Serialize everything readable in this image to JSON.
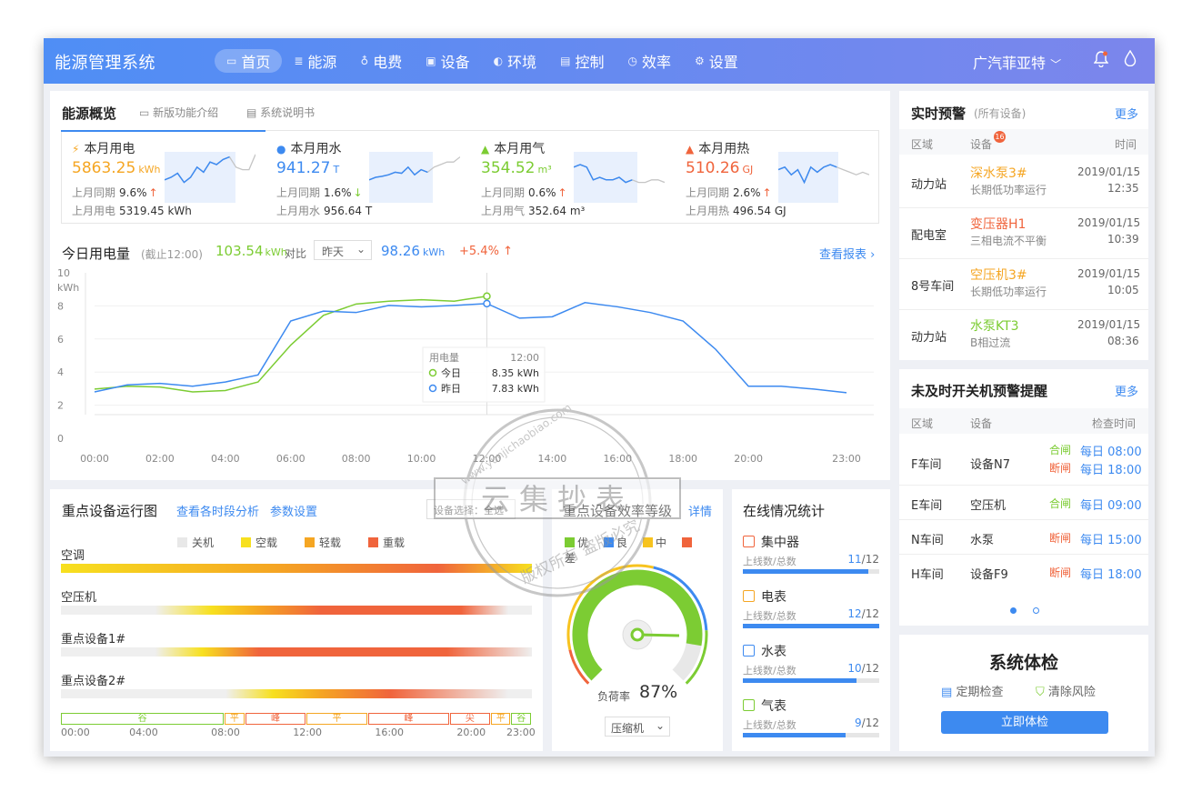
{
  "app": {
    "title": "能源管理系统"
  },
  "nav": [
    {
      "label": "首页",
      "icon": "monitor-icon",
      "active": true
    },
    {
      "label": "能源",
      "icon": "database-icon"
    },
    {
      "label": "电费",
      "icon": "bulb-icon"
    },
    {
      "label": "设备",
      "icon": "device-icon"
    },
    {
      "label": "环境",
      "icon": "leaf-icon"
    },
    {
      "label": "控制",
      "icon": "control-icon"
    },
    {
      "label": "效率",
      "icon": "clock-icon"
    },
    {
      "label": "设置",
      "icon": "gear-icon"
    }
  ],
  "header": {
    "company": "广汽菲亚特"
  },
  "overview": {
    "title": "能源概览",
    "link1": "新版功能介绍",
    "link2": "系统说明书",
    "metrics": [
      {
        "title": "本月用电",
        "value": "5863.25",
        "unit": "kWh",
        "yoy_label": "上月同期",
        "yoy": "9.6%",
        "prev_label": "上月用电",
        "prev": "5319.45 kWh",
        "color": "#f5a623",
        "icon": "lightning-icon",
        "spark": [
          0.55,
          0.5,
          0.42,
          0.6,
          0.5,
          0.3,
          0.4,
          0.2,
          0.25,
          0.15,
          0.1,
          0.3,
          0.35,
          0.35,
          0.05
        ],
        "fill": 0.78
      },
      {
        "title": "本月用水",
        "value": "941.27",
        "unit": "T",
        "yoy_label": "上月同期",
        "yoy": "1.6%",
        "prev_label": "上月用水",
        "prev": "956.64 T",
        "color": "#3d8af0",
        "icon": "water-drop-icon",
        "spark": [
          0.55,
          0.5,
          0.48,
          0.45,
          0.4,
          0.42,
          0.3,
          0.45,
          0.35,
          0.4,
          0.3,
          0.25,
          0.2,
          0.2,
          0.1
        ],
        "fill": 0.7
      },
      {
        "title": "本月用气",
        "value": "354.52",
        "unit": "m³",
        "yoy_label": "上月同期",
        "yoy": "0.6%",
        "prev_label": "上月用气",
        "prev": "352.64 m³",
        "color": "#7ccc33",
        "icon": "flame-icon",
        "spark": [
          0.3,
          0.25,
          0.3,
          0.55,
          0.5,
          0.55,
          0.55,
          0.5,
          0.6,
          0.55,
          0.6,
          0.6,
          0.55,
          0.55,
          0.6
        ],
        "fill": 0.7
      },
      {
        "title": "本月用热",
        "value": "510.26",
        "unit": "GJ",
        "yoy_label": "上月同期",
        "yoy": "2.6%",
        "prev_label": "上月用热",
        "prev": "496.54 GJ",
        "color": "#f0643c",
        "icon": "heat-icon",
        "spark": [
          0.35,
          0.3,
          0.45,
          0.35,
          0.6,
          0.3,
          0.4,
          0.3,
          0.25,
          0.3,
          0.35,
          0.4,
          0.45,
          0.4,
          0.45
        ],
        "fill": 0.66
      }
    ]
  },
  "today": {
    "title": "今日用电量",
    "note": "(截止12:00)",
    "value": "103.54",
    "unit": "kWh",
    "compare_label": "对比",
    "select": "昨天",
    "compare_value": "98.26",
    "compare_unit": "kWh",
    "change": "+5.4%",
    "report_link": "查看报表"
  },
  "chart_data": {
    "type": "line",
    "ylabel": "kWh",
    "ylim": [
      0,
      10
    ],
    "yticks": [
      "0",
      "2",
      "4",
      "6",
      "8",
      "10"
    ],
    "xticks": [
      "00:00",
      "02:00",
      "04:00",
      "06:00",
      "08:00",
      "10:00",
      "12:00",
      "14:00",
      "16:00",
      "18:00",
      "20:00",
      "23:00"
    ],
    "x_hours": [
      0,
      1,
      2,
      3,
      4,
      5,
      6,
      7,
      8,
      9,
      10,
      11,
      12,
      13,
      14,
      15,
      16,
      17,
      18,
      19,
      20,
      21,
      22,
      23
    ],
    "series": [
      {
        "name": "今日",
        "color": "#7ccc33",
        "values": [
          1.8,
          2.0,
          1.95,
          1.6,
          1.7,
          2.3,
          4.9,
          7.0,
          7.8,
          8.0,
          8.1,
          8.0,
          8.35
        ]
      },
      {
        "name": "昨日",
        "color": "#3d8af0",
        "values": [
          1.6,
          2.1,
          2.2,
          2.0,
          2.3,
          2.8,
          6.6,
          7.3,
          7.2,
          7.7,
          7.6,
          7.7,
          7.83,
          6.8,
          6.9,
          7.9,
          7.6,
          7.2,
          6.6,
          4.6,
          2.0,
          2.0,
          1.8,
          1.55
        ]
      }
    ],
    "tooltip": {
      "title": "用电量",
      "time": "12:00",
      "rows": [
        {
          "label": "今日",
          "value": "8.35 kWh"
        },
        {
          "label": "昨日",
          "value": "7.83 kWh"
        }
      ]
    }
  },
  "alerts": {
    "title": "实时预警",
    "subtitle": "(所有设备)",
    "more": "更多",
    "headers": [
      "区域",
      "设备",
      "时间"
    ],
    "badge": "16",
    "rows": [
      {
        "area": "动力站",
        "device": "深水泵3#",
        "desc": "长期低功率运行",
        "date": "2019/01/15",
        "time": "12:35",
        "color": "#f5a623"
      },
      {
        "area": "配电室",
        "device": "变压器H1",
        "desc": "三相电流不平衡",
        "date": "2019/01/15",
        "time": "10:39",
        "color": "#f0643c"
      },
      {
        "area": "8号车间",
        "device": "空压机3#",
        "desc": "长期低功率运行",
        "date": "2019/01/15",
        "time": "10:05",
        "color": "#f5a623"
      },
      {
        "area": "动力站",
        "device": "水泵KT3",
        "desc": "B相过流",
        "date": "2019/01/15",
        "time": "08:36",
        "color": "#7ccc33"
      }
    ]
  },
  "switch_alert": {
    "title": "未及时开关机预警提醒",
    "more": "更多",
    "headers": [
      "区域",
      "设备",
      "检查时间"
    ],
    "rows": [
      {
        "area": "F车间",
        "device": "设备N7",
        "items": [
          {
            "label": "合闸",
            "time": "每日 08:00",
            "color": "#7ccc33"
          },
          {
            "label": "断闸",
            "time": "每日 18:00",
            "color": "#f0643c"
          }
        ]
      },
      {
        "area": "E车间",
        "device": "空压机",
        "items": [
          {
            "label": "合闸",
            "time": "每日 09:00",
            "color": "#7ccc33"
          }
        ]
      },
      {
        "area": "N车间",
        "device": "水泵",
        "items": [
          {
            "label": "断闸",
            "time": "每日 15:00",
            "color": "#f0643c"
          }
        ]
      },
      {
        "area": "H车间",
        "device": "设备F9",
        "items": [
          {
            "label": "断闸",
            "time": "每日 18:00",
            "color": "#f0643c"
          }
        ]
      }
    ]
  },
  "checkup": {
    "title": "系统体检",
    "item1": "定期检查",
    "item2": "清除风险",
    "button": "立即体检"
  },
  "device_run": {
    "title": "重点设备运行图",
    "link1": "查看各时段分析",
    "link2": "参数设置",
    "select": "设备选择：全选",
    "legend": [
      {
        "label": "关机",
        "color": "#e8e8e8"
      },
      {
        "label": "空载",
        "color": "#f7e01f"
      },
      {
        "label": "轻载",
        "color": "#f5a623"
      },
      {
        "label": "重载",
        "color": "#f0643c"
      }
    ],
    "devices": [
      "空调",
      "空压机",
      "重点设备1#",
      "重点设备2#"
    ],
    "periods": [
      {
        "label": "谷",
        "span": [
          0,
          8
        ],
        "color": "#7ccc33"
      },
      {
        "label": "平",
        "span": [
          8,
          9
        ],
        "color": "#f5a623"
      },
      {
        "label": "峰",
        "span": [
          9,
          12
        ],
        "color": "#f0643c"
      },
      {
        "label": "平",
        "span": [
          12,
          15
        ],
        "color": "#f5a623"
      },
      {
        "label": "峰",
        "span": [
          15,
          19
        ],
        "color": "#f0643c"
      },
      {
        "label": "尖",
        "span": [
          19,
          21
        ],
        "color": "#f0643c"
      },
      {
        "label": "平",
        "span": [
          21,
          22
        ],
        "color": "#f5a623"
      },
      {
        "label": "谷",
        "span": [
          22,
          23
        ],
        "color": "#7ccc33"
      }
    ],
    "time_ticks": [
      "00:00",
      "04:00",
      "08:00",
      "12:00",
      "16:00",
      "20:00",
      "23:00"
    ]
  },
  "efficiency": {
    "title": "重点设备效率等级",
    "link": "详情",
    "legend": [
      {
        "label": "优",
        "color": "#7ccc33"
      },
      {
        "label": "良",
        "color": "#3d8af0"
      },
      {
        "label": "中",
        "color": "#f7c31f"
      },
      {
        "label": "差",
        "color": "#f0643c"
      }
    ],
    "gauge_label": "负荷率",
    "gauge_value": "87%",
    "gauge_level": 0.87,
    "select": "压缩机"
  },
  "online": {
    "title": "在线情况统计",
    "items": [
      {
        "name": "集中器",
        "label": "上线数/总数",
        "online": "11",
        "total": "12",
        "color": "#f0643c",
        "ratio": 0.9167
      },
      {
        "name": "电表",
        "label": "上线数/总数",
        "online": "12",
        "total": "12",
        "color": "#f5a623",
        "ratio": 1
      },
      {
        "name": "水表",
        "label": "上线数/总数",
        "online": "10",
        "total": "12",
        "color": "#3d8af0",
        "ratio": 0.8333
      },
      {
        "name": "气表",
        "label": "上线数/总数",
        "online": "9",
        "total": "12",
        "color": "#7ccc33",
        "ratio": 0.75
      }
    ]
  },
  "watermark": {
    "url": "www.yunjichaobiao.com",
    "brand": "云集抄表",
    "slogan": "版权所有  盗版必究"
  }
}
